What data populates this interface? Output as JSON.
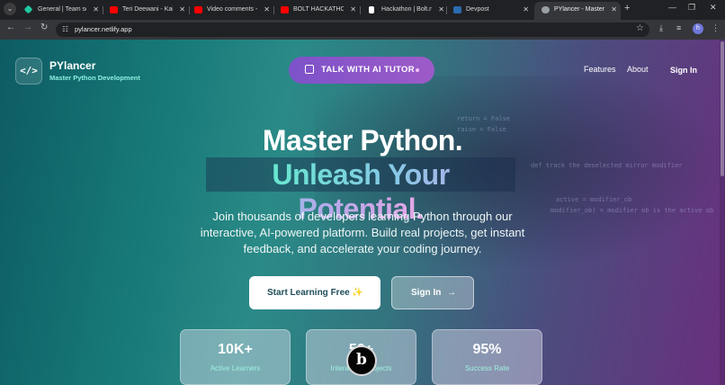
{
  "browser": {
    "tabs": [
      {
        "label": "General | Team setti",
        "fav_color": "#1ec8a0"
      },
      {
        "label": "Teri Deewani - Kailas",
        "fav_color": "#ff0000"
      },
      {
        "label": "Video comments - Yo",
        "fav_color": "#ff0000"
      },
      {
        "label": "BOLT HACKATHON !!",
        "fav_color": "#ff0000"
      },
      {
        "label": "Hackathon | Bolt.new",
        "fav_color": "#ffffff"
      },
      {
        "label": "Devpost",
        "fav_color": "#2b6cb0"
      },
      {
        "label": "PYlancer - Master Py",
        "fav_color": "#9aa0a6"
      }
    ],
    "url": "pylancer.netlify.app",
    "profile_initial": "h"
  },
  "brand": {
    "logo_text": "</>",
    "name": "PYlancer",
    "tagline": "Master Python Development"
  },
  "nav": {
    "tutor_button": "TALK WITH AI TUTOR",
    "features": "Features",
    "about": "About",
    "sign_in": "Sign In"
  },
  "hero": {
    "title_line1": "Master Python.",
    "title_line2": "Unleash Your Potential.",
    "subtitle": "Join thousands of developers learning Python through our interactive, AI-powered platform. Build real projects, get instant feedback, and accelerate your coding journey.",
    "cta_primary": "Start Learning Free",
    "cta_secondary": "Sign In"
  },
  "stats": [
    {
      "value": "10K+",
      "label": "Active Learners"
    },
    {
      "value": "50+",
      "label": "Interactive Projects"
    },
    {
      "value": "95%",
      "label": "Success Rate"
    }
  ],
  "background_code": [
    "return = False",
    "raise = False",
    "def track the deselected mirror modifier",
    "active = modifier_ob",
    "modifier_ob) = modifier ob is the active ob"
  ],
  "badge": {
    "letter": "b"
  }
}
